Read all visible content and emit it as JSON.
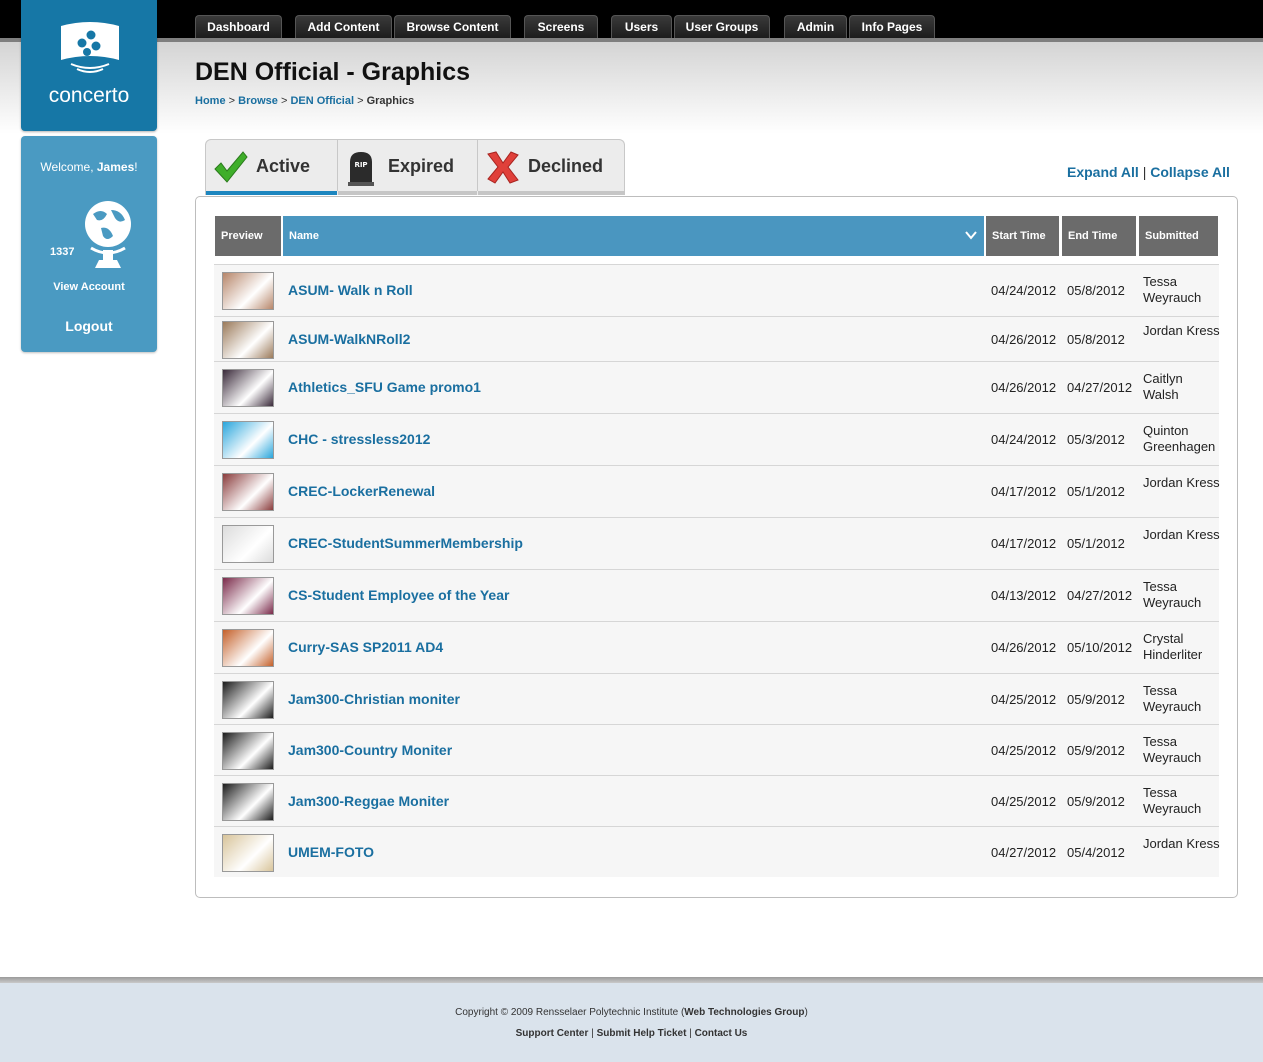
{
  "nav": {
    "tabs": [
      "Dashboard",
      "Add Content",
      "Browse Content",
      "Screens",
      "Users",
      "User Groups",
      "Admin",
      "Info Pages"
    ]
  },
  "logo": {
    "text": "concerto"
  },
  "sidebar": {
    "welcome_prefix": "Welcome, ",
    "user_name": "James",
    "welcome_suffix": "!",
    "points": "1337",
    "view_account": "View Account",
    "logout": "Logout"
  },
  "page": {
    "title": "DEN Official - Graphics",
    "breadcrumb": [
      "Home",
      "Browse",
      "DEN Official",
      "Graphics"
    ],
    "breadcrumb_sep": ">"
  },
  "status_tabs": [
    {
      "label": "Active",
      "icon": "checkmark-icon",
      "selected": true
    },
    {
      "label": "Expired",
      "icon": "tombstone-icon",
      "selected": false
    },
    {
      "label": "Declined",
      "icon": "x-mark-icon",
      "selected": false
    }
  ],
  "expand_collapse": {
    "expand": "Expand All",
    "sep": "|",
    "collapse": "Collapse All"
  },
  "table": {
    "headers": {
      "preview": "Preview",
      "name": "Name",
      "start": "Start Time",
      "end": "End Time",
      "submitted": "Submitted"
    },
    "rows": [
      {
        "name": "ASUM- Walk n Roll",
        "start": "04/24/2012",
        "end": "05/8/2012",
        "submitted": "Tessa Weyrauch",
        "thumb_color": "#b7866a"
      },
      {
        "name": "ASUM-WalkNRoll2",
        "start": "04/26/2012",
        "end": "05/8/2012",
        "submitted": "Jordan Kress",
        "thumb_color": "#9b7a5a"
      },
      {
        "name": "Athletics_SFU Game promo1",
        "start": "04/26/2012",
        "end": "04/27/2012",
        "submitted": "Caitlyn Walsh",
        "thumb_color": "#3a2a3a"
      },
      {
        "name": "CHC - stressless2012",
        "start": "04/24/2012",
        "end": "05/3/2012",
        "submitted": "Quinton Greenhagen",
        "thumb_color": "#2aa6dc"
      },
      {
        "name": "CREC-LockerRenewal",
        "start": "04/17/2012",
        "end": "05/1/2012",
        "submitted": "Jordan Kress",
        "thumb_color": "#8a3c3c"
      },
      {
        "name": "CREC-StudentSummerMembership",
        "start": "04/17/2012",
        "end": "05/1/2012",
        "submitted": "Jordan Kress",
        "thumb_color": "#dcdcdc"
      },
      {
        "name": "CS-Student Employee of the Year",
        "start": "04/13/2012",
        "end": "04/27/2012",
        "submitted": "Tessa Weyrauch",
        "thumb_color": "#7a2a4a"
      },
      {
        "name": "Curry-SAS SP2011 AD4",
        "start": "04/26/2012",
        "end": "05/10/2012",
        "submitted": "Crystal Hinderliter",
        "thumb_color": "#c4602a"
      },
      {
        "name": "Jam300-Christian moniter",
        "start": "04/25/2012",
        "end": "05/9/2012",
        "submitted": "Tessa Weyrauch",
        "thumb_color": "#1c1c1c"
      },
      {
        "name": "Jam300-Country Moniter",
        "start": "04/25/2012",
        "end": "05/9/2012",
        "submitted": "Tessa Weyrauch",
        "thumb_color": "#1c1c1c"
      },
      {
        "name": "Jam300-Reggae Moniter",
        "start": "04/25/2012",
        "end": "05/9/2012",
        "submitted": "Tessa Weyrauch",
        "thumb_color": "#1c1c1c"
      },
      {
        "name": "UMEM-FOTO",
        "start": "04/27/2012",
        "end": "05/4/2012",
        "submitted": "Jordan Kress",
        "thumb_color": "#d8c49a"
      }
    ]
  },
  "footer": {
    "copyright_prefix": "Copyright © 2009 Rensselaer Polytechnic Institute (",
    "copyright_group": "Web Technologies Group",
    "copyright_suffix": ")",
    "links": [
      "Support Center",
      "Submit Help Ticket",
      "Contact Us"
    ],
    "sep": "|"
  },
  "colors": {
    "brand_blue": "#1677a6",
    "sidebar_blue": "#4a9ac2",
    "link_blue": "#1a6fa0",
    "header_gray": "#6b6b6b",
    "name_header_blue": "#4a96c0"
  }
}
